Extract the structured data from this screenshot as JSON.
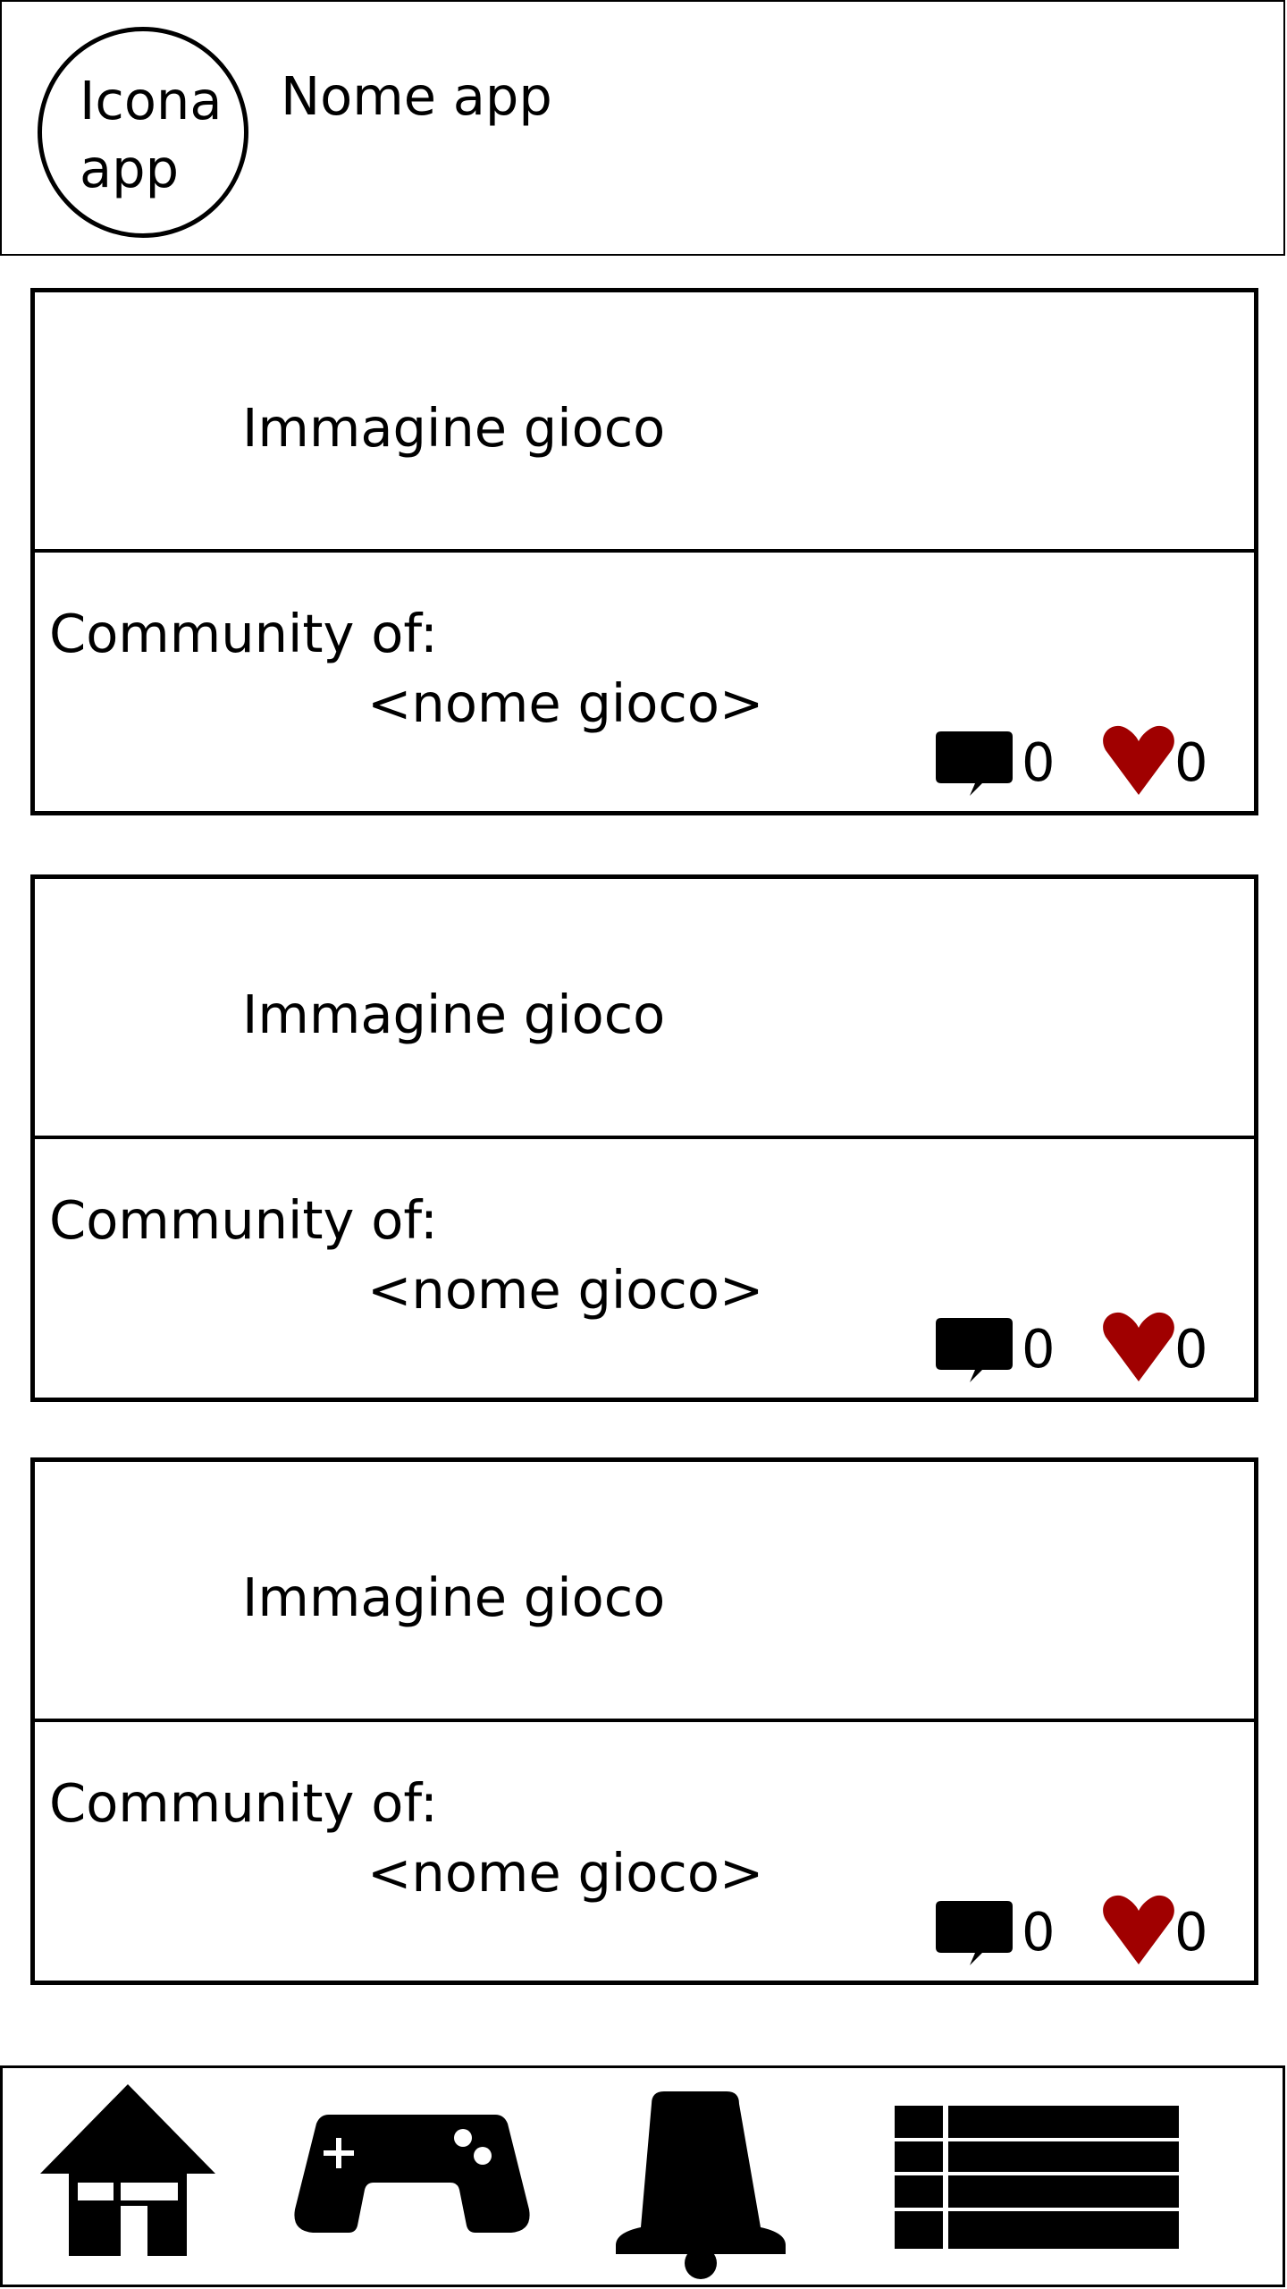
{
  "header": {
    "app_icon_text": "Icona\napp",
    "app_name": "Nome app"
  },
  "cards": [
    {
      "image_label": "Immagine gioco",
      "community_label": "Community of:",
      "game_name": "<nome gioco>",
      "comments": "0",
      "likes": "0"
    },
    {
      "image_label": "Immagine gioco",
      "community_label": "Community of:",
      "game_name": "<nome gioco>",
      "comments": "0",
      "likes": "0"
    },
    {
      "image_label": "Immagine gioco",
      "community_label": "Community of:",
      "game_name": "<nome gioco>",
      "comments": "0",
      "likes": "0"
    }
  ],
  "colors": {
    "heart": "#a00000",
    "ink": "#000000",
    "background": "#ffffff"
  },
  "nav": {
    "items": [
      {
        "icon": "home-icon"
      },
      {
        "icon": "gamepad-icon"
      },
      {
        "icon": "bell-icon"
      },
      {
        "icon": "list-icon"
      }
    ]
  }
}
